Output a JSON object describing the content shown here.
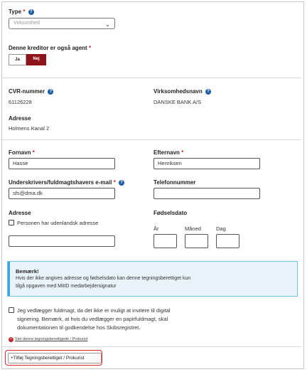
{
  "type_field": {
    "label": "Type",
    "required_mark": "*",
    "placeholder": "Virksomhed"
  },
  "agent": {
    "label": "Denne kreditor er også agent",
    "required_mark": "*",
    "yes_label": "Ja",
    "no_label": "Nej",
    "selected": "Nej"
  },
  "company": {
    "cvr_label": "CVR-nummer",
    "cvr_value": "61126228",
    "name_label": "Virksomhedsnavn",
    "name_value": "DANSKE BANK A/S",
    "address_label": "Adresse",
    "address_value": "Holmens Kanal 2"
  },
  "signatory": {
    "first_name_label": "Fornavn",
    "first_name_value": "Hasse",
    "last_name_label": "Efternavn",
    "last_name_value": "Henriksen",
    "email_label": "Underskrivers/fuldmagtshavers e-mail",
    "email_value": "sfs@dma.dk",
    "phone_label": "Telefonnummer",
    "phone_value": "",
    "address_label": "Adresse",
    "foreign_address_label": "Personen har udenlandsk adresse",
    "address_value": "",
    "birthdate_label": "Fødselsdato",
    "year_label": "År",
    "month_label": "Måned",
    "day_label": "Dag",
    "required_mark": "*"
  },
  "notice": {
    "title": "Bemærk!",
    "line1": "Hvis der ikke angives adresse og fødselsdato kan denne tegningsberettiget kun",
    "line2": "tilgå opgaven med MitID medarbejdersignatur"
  },
  "proxy": {
    "line1": "Jeg vedlægger fuldmagt, da det ikke er muligt at invitere til digital",
    "line2": "signering. Bemærk, at hvis du vedlægger en papirfuldmagt, skal",
    "line3": "dokumentationen til godkendelse hos Skibsregistret."
  },
  "delete_link": "Slet denne tegningsberettigede / Prokurist",
  "add_button": "+Tilføj Tegningsberettiget / Prokurist",
  "colors": {
    "accent_red": "#8f1419",
    "help_blue": "#1d5ea8",
    "info_border": "#6fc0e3",
    "highlight_red": "#d62b2b"
  }
}
